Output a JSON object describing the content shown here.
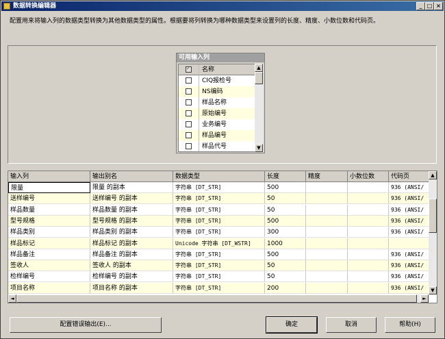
{
  "window": {
    "title": "数据转换编辑器"
  },
  "description": "配置用来将输入列的数据类型转换为其他数据类型的属性。根据要将列转换为哪种数据类型来设置列的长度、精度、小数位数和代码页。",
  "available": {
    "title": "可用输入列",
    "header": "名称",
    "items": [
      "CIQ报检号",
      "NS编码",
      "样品名称",
      "原始编号",
      "业务编号",
      "样品编号",
      "样品代号"
    ]
  },
  "grid": {
    "headers": [
      "输入列",
      "输出别名",
      "数据类型",
      "长度",
      "精度",
      "小数位数",
      "代码页"
    ],
    "rows": [
      [
        "限量",
        "限量 的副本",
        "字符串 [DT_STR]",
        "500",
        "",
        "",
        "936   (ANSI/"
      ],
      [
        "送样编号",
        "送样编号 的副本",
        "字符串 [DT_STR]",
        "50",
        "",
        "",
        "936   (ANSI/"
      ],
      [
        "样品数量",
        "样品数量 的副本",
        "字符串 [DT_STR]",
        "50",
        "",
        "",
        "936   (ANSI/"
      ],
      [
        "型号规格",
        "型号规格 的副本",
        "字符串 [DT_STR]",
        "500",
        "",
        "",
        "936   (ANSI/"
      ],
      [
        "样品类别",
        "样品类别 的副本",
        "字符串 [DT_STR]",
        "300",
        "",
        "",
        "936   (ANSI/"
      ],
      [
        "样品标记",
        "样品标记 的副本",
        "Unicode 字符串 [DT_WSTR]",
        "1000",
        "",
        "",
        ""
      ],
      [
        "样品备注",
        "样品备注 的副本",
        "字符串 [DT_STR]",
        "500",
        "",
        "",
        "936   (ANSI/"
      ],
      [
        "签收人",
        "签收人 的副本",
        "字符串 [DT_STR]",
        "50",
        "",
        "",
        "936   (ANSI/"
      ],
      [
        "检样编号",
        "检样编号 的副本",
        "字符串 [DT_STR]",
        "50",
        "",
        "",
        "936   (ANSI/"
      ],
      [
        "项目名称",
        "项目名称 的副本",
        "字符串 [DT_STR]",
        "200",
        "",
        "",
        "936   (ANSI/"
      ]
    ]
  },
  "buttons": {
    "error_output": "配置错误输出(E)...",
    "ok": "确定",
    "cancel": "取消",
    "help": "帮助(H)"
  },
  "colors": {
    "title_start": "#0a246a",
    "title_end": "#3a6ea5",
    "row_alt": "#ffffe0"
  }
}
